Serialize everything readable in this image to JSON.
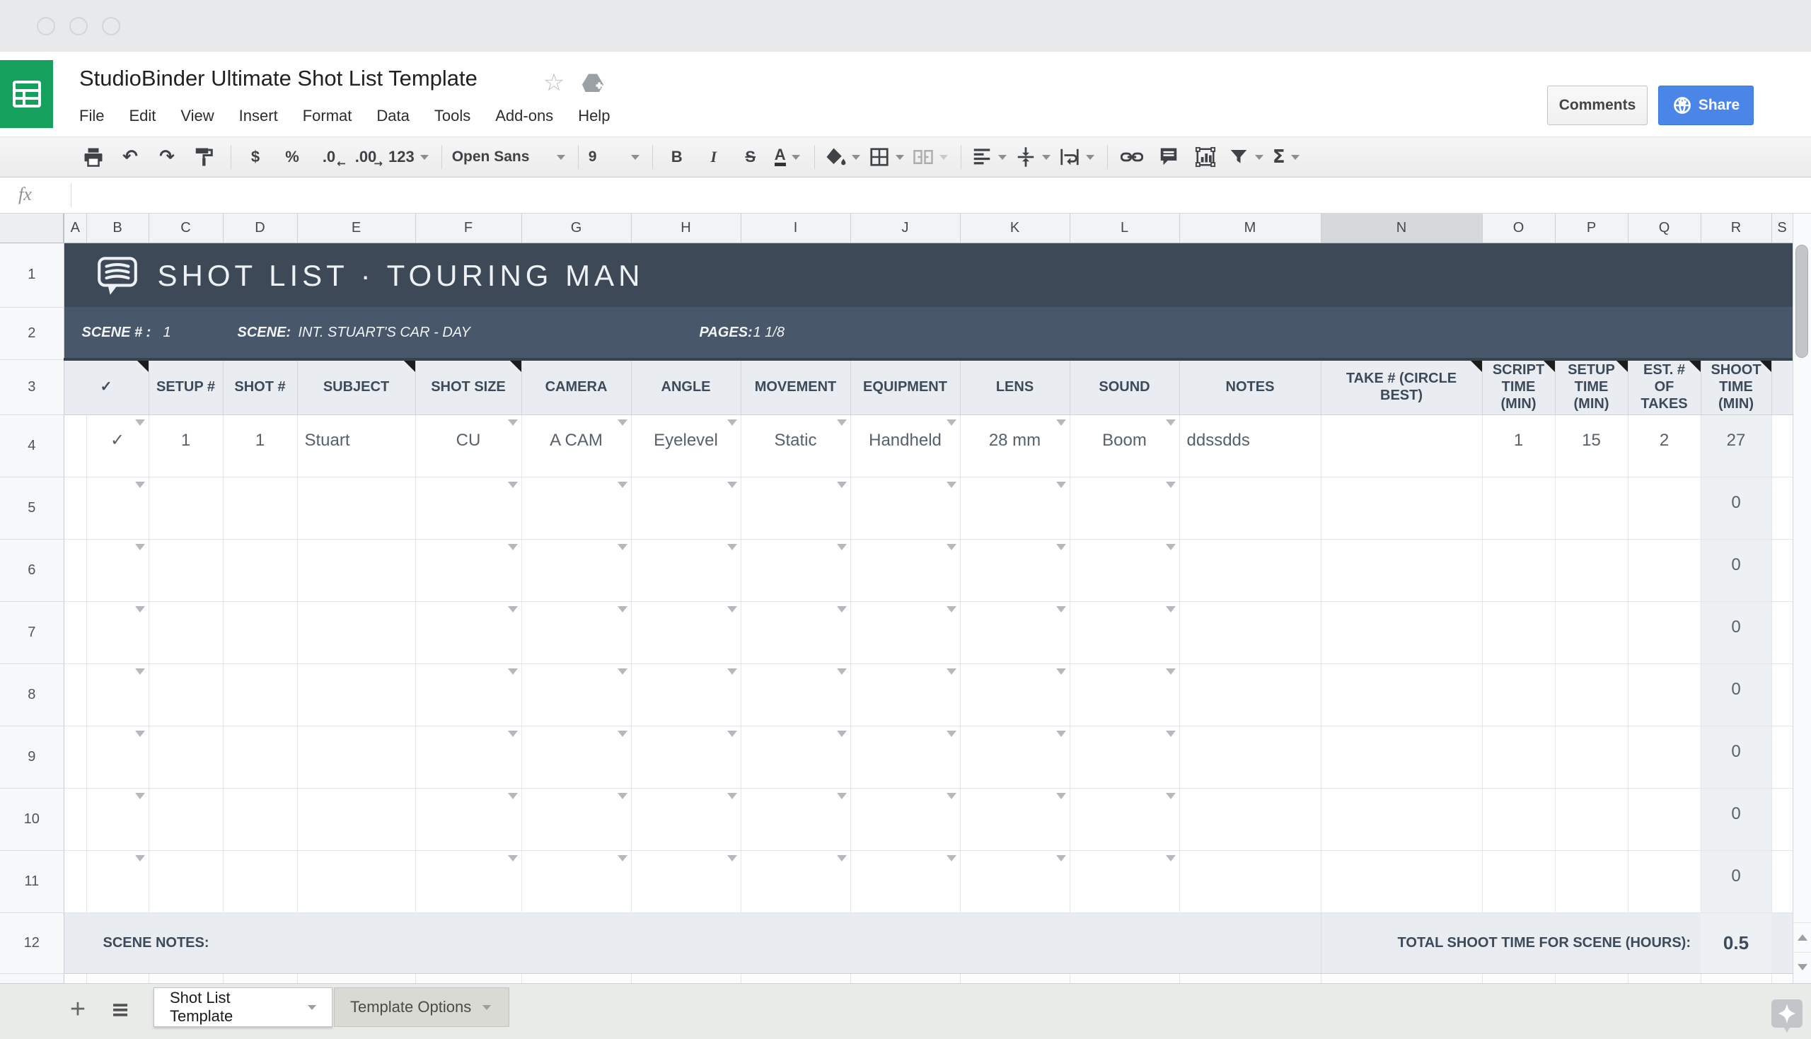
{
  "window": {
    "title": "StudioBinder Ultimate Shot List Template"
  },
  "menu": {
    "items": [
      "File",
      "Edit",
      "View",
      "Insert",
      "Format",
      "Data",
      "Tools",
      "Add-ons",
      "Help"
    ]
  },
  "actions": {
    "comments": "Comments",
    "share": "Share"
  },
  "toolbar": {
    "currency": "$",
    "percent": "%",
    "decrease_decimal": ".0",
    "increase_decimal": ".00",
    "more_formats": "123",
    "font_name": "Open Sans",
    "font_size": "9",
    "bold": "B",
    "italic": "I",
    "strikethrough": "S",
    "text_color": "A",
    "functions": "Σ"
  },
  "icons": {
    "undo": "↶",
    "redo": "↷",
    "star": "☆",
    "plus": "+",
    "hamburger": "≡",
    "fx": "fx",
    "left_arrow": "←",
    "right_arrow": "→"
  },
  "formula_bar": {
    "value": ""
  },
  "columns": {
    "letters": [
      "A",
      "B",
      "C",
      "D",
      "E",
      "F",
      "G",
      "H",
      "I",
      "J",
      "K",
      "L",
      "M",
      "N",
      "O",
      "P",
      "Q",
      "R",
      "S"
    ],
    "selected": "N"
  },
  "rows": {
    "numbers": [
      "1",
      "2",
      "3",
      "4",
      "5",
      "6",
      "7",
      "8",
      "9",
      "10",
      "11",
      "12"
    ]
  },
  "sheet": {
    "title": "SHOT LIST · TOURING MAN",
    "scene": {
      "number_label": "SCENE # :",
      "number": "1",
      "label": "SCENE:",
      "name": "INT. STUART'S CAR - DAY",
      "pages_label": "PAGES:",
      "pages": "1 1/8"
    },
    "headers": {
      "check": "✓",
      "setup": "SETUP #",
      "shot": "SHOT #",
      "subject": "SUBJECT",
      "shot_size": "SHOT SIZE",
      "camera": "CAMERA",
      "angle": "ANGLE",
      "movement": "MOVEMENT",
      "equipment": "EQUIPMENT",
      "lens": "LENS",
      "sound": "SOUND",
      "notes": "NOTES",
      "take": "TAKE # (CIRCLE BEST)",
      "script_time": "SCRIPT TIME (MIN)",
      "setup_time": "SETUP TIME (MIN)",
      "est_takes": "EST. # OF TAKES",
      "shoot_time": "SHOOT TIME (MIN)"
    },
    "shot1": {
      "check": "✓",
      "setup": "1",
      "shot": "1",
      "subject": "Stuart",
      "shot_size": "CU",
      "camera": "A CAM",
      "angle": "Eyelevel",
      "movement": "Static",
      "equipment": "Handheld",
      "lens": "28 mm",
      "sound": "Boom",
      "notes": "ddssdds",
      "take": "",
      "script_time": "1",
      "setup_time": "15",
      "est_takes": "2",
      "shoot_time": "27"
    },
    "empty_shoot_time": "0",
    "footer": {
      "notes_label": "SCENE NOTES:",
      "total_label": "TOTAL SHOOT TIME FOR SCENE (HOURS):",
      "total": "0.5"
    }
  },
  "tabs": {
    "sheet1": "Shot List Template",
    "sheet2": "Template Options"
  },
  "colors": {
    "sheets_green": "#16a05d",
    "share_blue": "#4a86e8",
    "header_navy": "#3d4956",
    "subheader_navy": "#485769",
    "table_header_bg": "#e9edf1",
    "calc_col_bg": "#eef1f4"
  }
}
